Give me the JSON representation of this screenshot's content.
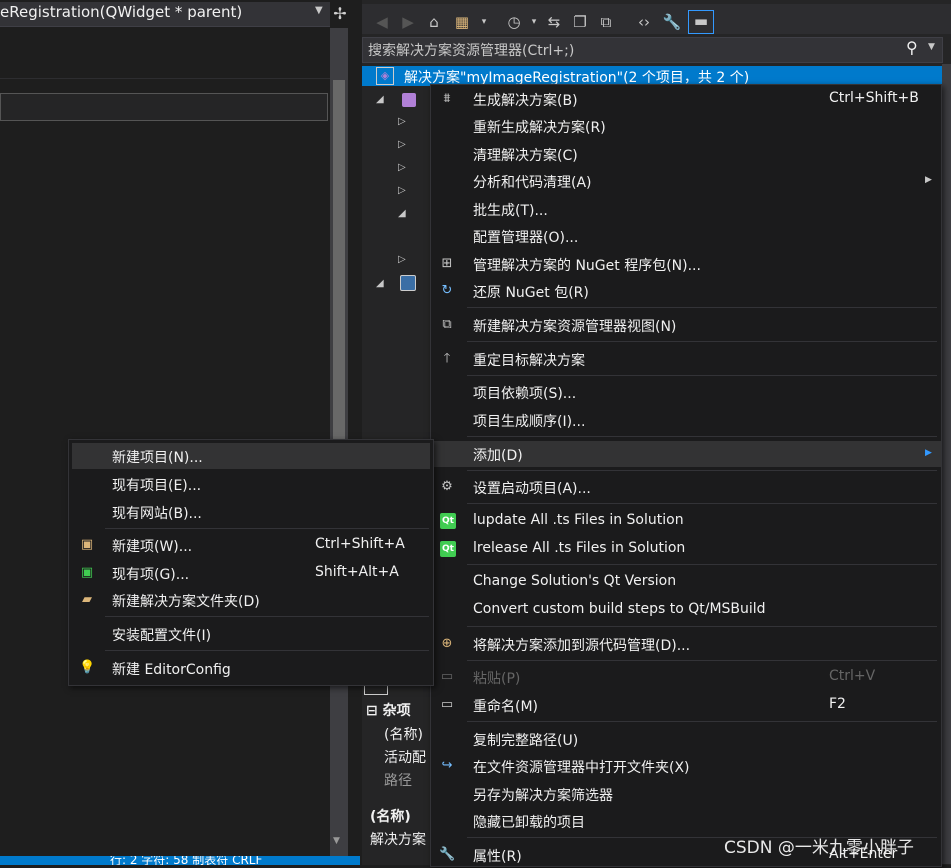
{
  "editor": {
    "function_combo": "eRegistration(QWidget * parent)",
    "split_icon": "split-icon"
  },
  "statusbar": {
    "text": "行: 2    字符: 58    制表符    CRLF"
  },
  "solution_explorer": {
    "toolbar_icons": [
      "back-icon",
      "forward-icon",
      "home-icon",
      "switch-views-icon",
      "history-icon",
      "sync-icon",
      "collapse-icon",
      "show-all-files-icon",
      "code-icon",
      "properties-wrench-icon",
      "preview-icon"
    ],
    "search_placeholder": "搜索解决方案资源管理器(Ctrl+;)",
    "solution_row": "解决方案\"myImageRegistration\"(2 个项目，共 2 个)"
  },
  "properties": {
    "category": "杂项",
    "rows": [
      "(名称)",
      "活动配",
      "路径"
    ],
    "footer_title": "(名称)",
    "footer_desc": "解决方案"
  },
  "main_menu": {
    "items": [
      {
        "label": "生成解决方案(B)",
        "shortcut": "Ctrl+Shift+B",
        "icon": "build-icon"
      },
      {
        "label": "重新生成解决方案(R)",
        "shortcut": "",
        "icon": ""
      },
      {
        "label": "清理解决方案(C)",
        "shortcut": "",
        "icon": ""
      },
      {
        "label": "分析和代码清理(A)",
        "shortcut": "",
        "icon": "",
        "submenu": true
      },
      {
        "label": "批生成(T)...",
        "shortcut": "",
        "icon": ""
      },
      {
        "label": "配置管理器(O)...",
        "shortcut": "",
        "icon": ""
      },
      {
        "label": "管理解决方案的 NuGet 程序包(N)...",
        "shortcut": "",
        "icon": "nuget-package-icon"
      },
      {
        "label": "还原 NuGet 包(R)",
        "shortcut": "",
        "icon": "restore-icon"
      },
      {
        "label": "新建解决方案资源管理器视图(N)",
        "shortcut": "",
        "icon": "new-view-icon"
      },
      {
        "label": "重定目标解决方案",
        "shortcut": "",
        "icon": "retarget-arrow-icon"
      },
      {
        "label": "项目依赖项(S)...",
        "shortcut": "",
        "icon": ""
      },
      {
        "label": "项目生成顺序(I)...",
        "shortcut": "",
        "icon": ""
      },
      {
        "label": "添加(D)",
        "shortcut": "",
        "icon": "",
        "submenu": true
      },
      {
        "label": "设置启动项目(A)...",
        "shortcut": "",
        "icon": "gear-icon"
      },
      {
        "label": "lupdate All .ts Files in Solution",
        "shortcut": "",
        "icon": "qt-icon"
      },
      {
        "label": "lrelease All .ts Files in Solution",
        "shortcut": "",
        "icon": "qt-icon"
      },
      {
        "label": "Change Solution's Qt Version",
        "shortcut": "",
        "icon": ""
      },
      {
        "label": "Convert custom build steps to Qt/MSBuild",
        "shortcut": "",
        "icon": ""
      },
      {
        "label": "将解决方案添加到源代码管理(D)...",
        "shortcut": "",
        "icon": "source-control-icon"
      },
      {
        "label": "粘贴(P)",
        "shortcut": "Ctrl+V",
        "icon": "paste-icon",
        "disabled": true
      },
      {
        "label": "重命名(M)",
        "shortcut": "F2",
        "icon": "rename-icon"
      },
      {
        "label": "复制完整路径(U)",
        "shortcut": "",
        "icon": ""
      },
      {
        "label": "在文件资源管理器中打开文件夹(X)",
        "shortcut": "",
        "icon": "open-folder-arrow-icon"
      },
      {
        "label": "另存为解决方案筛选器",
        "shortcut": "",
        "icon": ""
      },
      {
        "label": "隐藏已卸载的项目",
        "shortcut": "",
        "icon": ""
      },
      {
        "label": "属性(R)",
        "shortcut": "Alt+Enter",
        "icon": "wrench-icon"
      }
    ]
  },
  "add_submenu": {
    "items": [
      {
        "label": "新建项目(N)...",
        "shortcut": "",
        "icon": ""
      },
      {
        "label": "现有项目(E)...",
        "shortcut": "",
        "icon": ""
      },
      {
        "label": "现有网站(B)...",
        "shortcut": "",
        "icon": ""
      },
      {
        "label": "新建项(W)...",
        "shortcut": "Ctrl+Shift+A",
        "icon": "new-item-icon"
      },
      {
        "label": "现有项(G)...",
        "shortcut": "Shift+Alt+A",
        "icon": "existing-item-icon"
      },
      {
        "label": "新建解决方案文件夹(D)",
        "shortcut": "",
        "icon": "new-folder-icon"
      },
      {
        "label": "安装配置文件(I)",
        "shortcut": "",
        "icon": ""
      },
      {
        "label": "新建 EditorConfig",
        "shortcut": "",
        "icon": "lightbulb-icon"
      }
    ]
  },
  "watermark": "CSDN @一米九零小胖子"
}
